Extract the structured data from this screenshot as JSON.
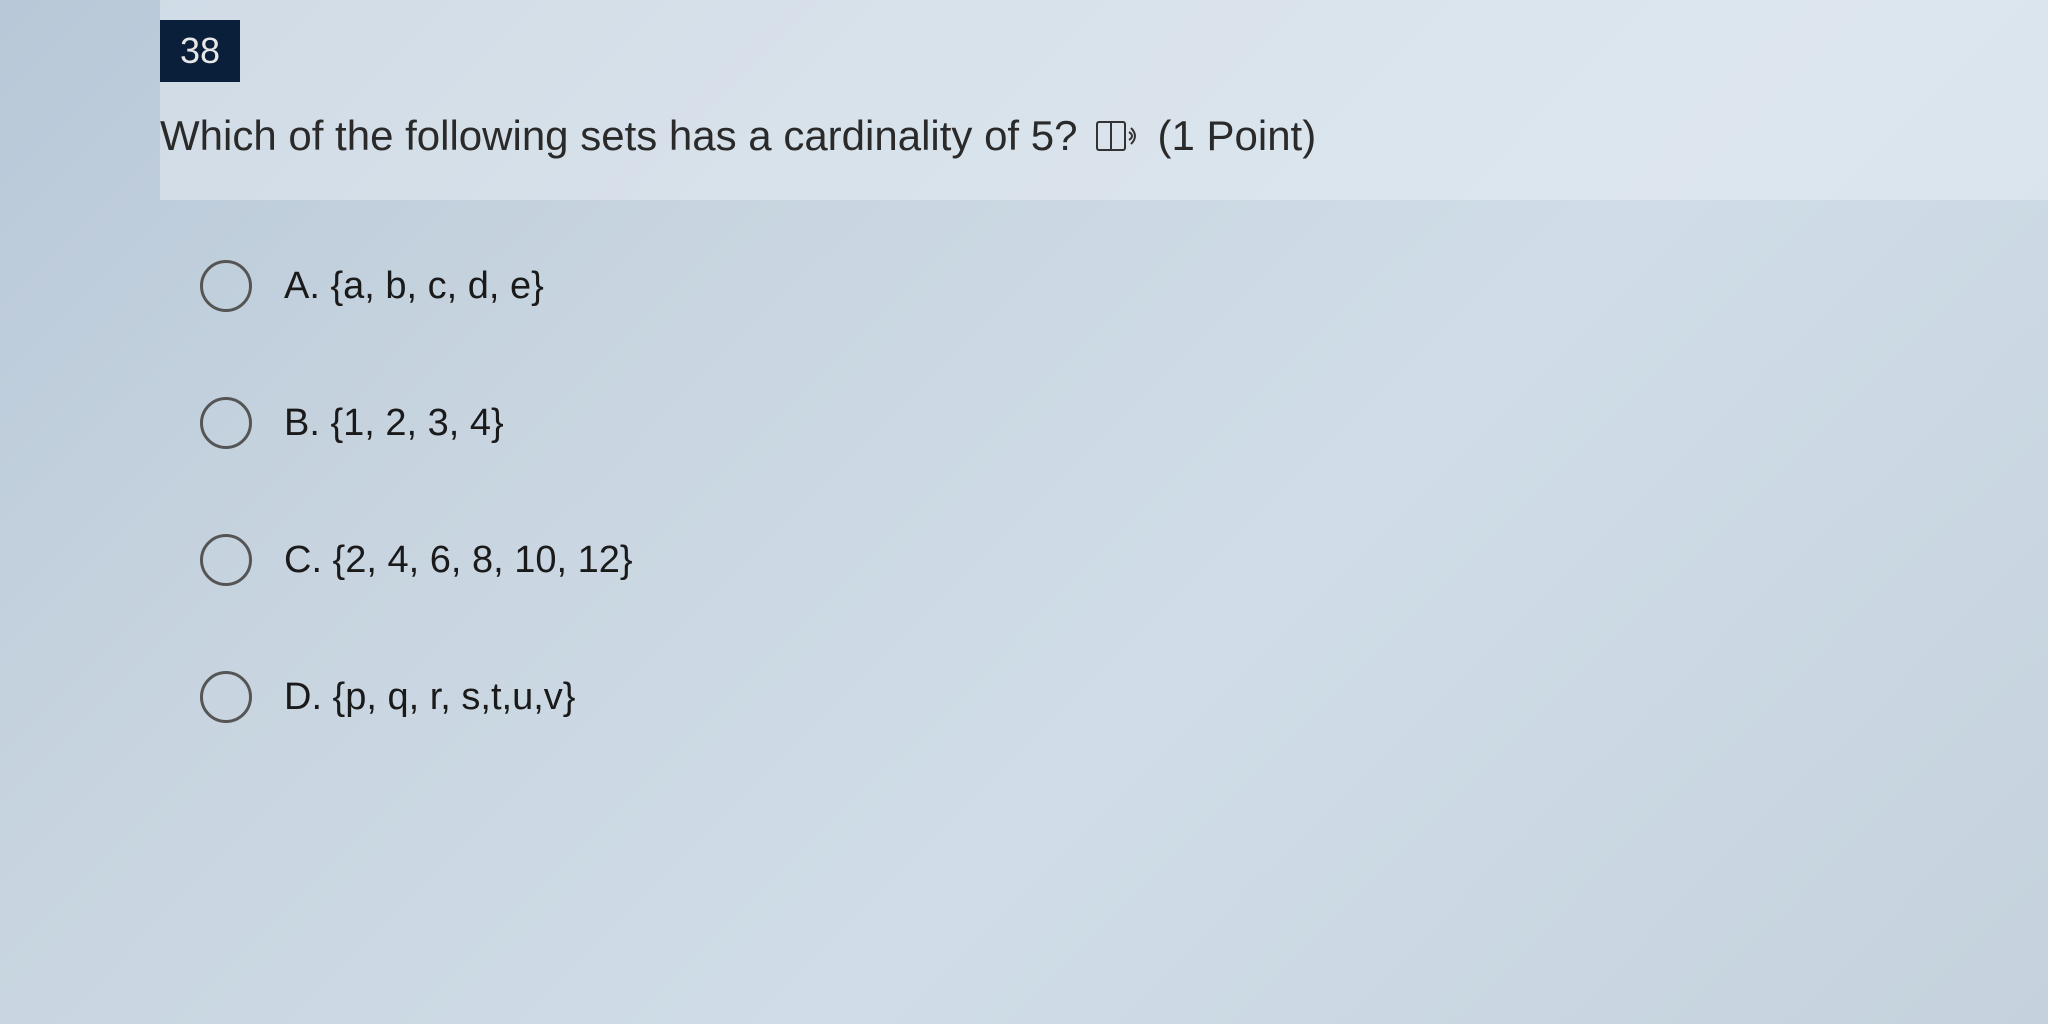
{
  "question": {
    "number": "38",
    "text": "Which of the following sets has a cardinality of 5?",
    "points": "(1 Point)"
  },
  "options": [
    {
      "label": "A. {a, b, c, d, e}"
    },
    {
      "label": "B. {1, 2, 3, 4}"
    },
    {
      "label": "C. {2, 4, 6, 8, 10, 12}"
    },
    {
      "label": "D. {p, q, r, s,t,u,v}"
    }
  ]
}
